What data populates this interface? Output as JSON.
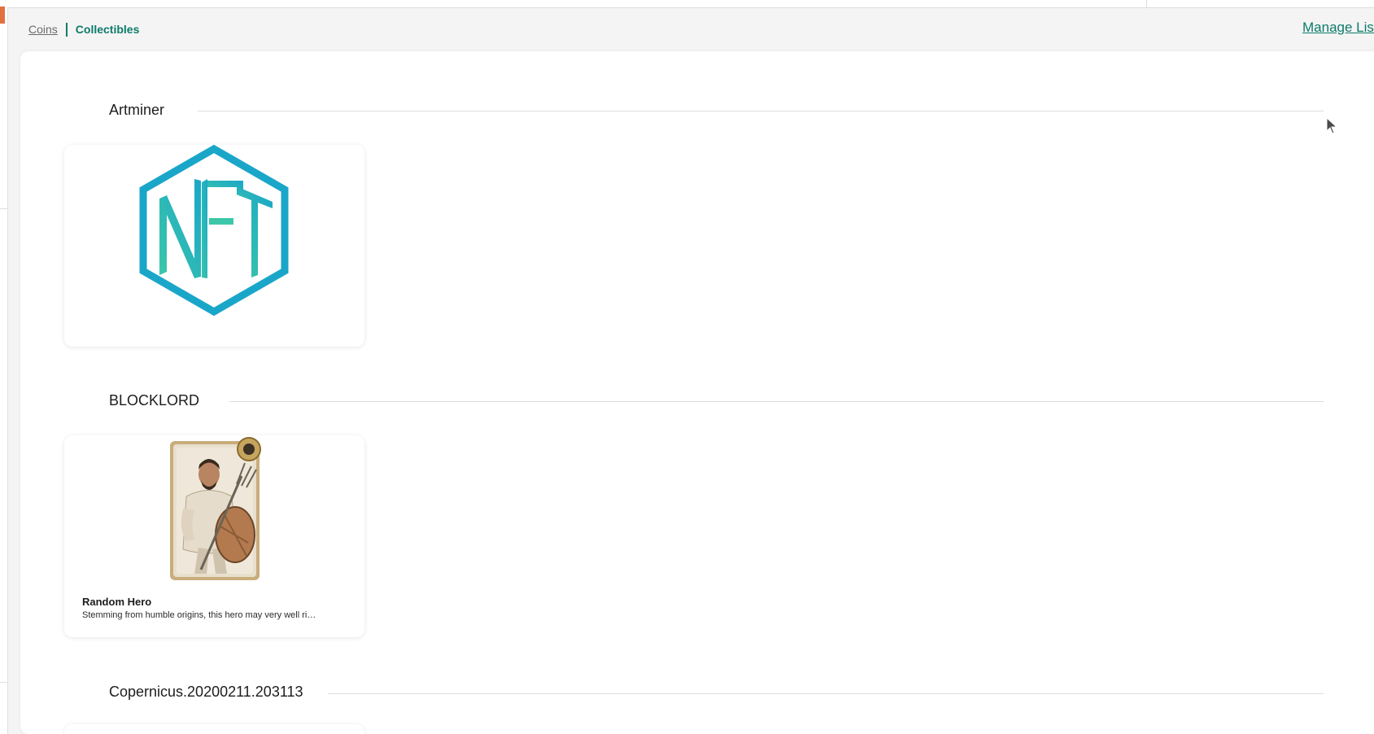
{
  "tabs": {
    "coins_label": "Coins",
    "collectibles_label": "Collectibles",
    "active": "Collectibles"
  },
  "manage_list_label": "Manage List",
  "colors": {
    "accent": "#0b7b6a",
    "nft_logo_blue": "#1aa6c9",
    "nft_logo_green": "#3cc7a8"
  },
  "groups": [
    {
      "name": "Artminer",
      "items": [
        {
          "title": "",
          "description": "",
          "image_icon": "nft-logo-icon"
        }
      ]
    },
    {
      "name": "BLOCKLORD",
      "items": [
        {
          "title": "Random Hero",
          "description": "Stemming from humble origins, this hero may very well ri…",
          "image_icon": "hero-card-image"
        }
      ]
    },
    {
      "name": "Copernicus.20200211.203113",
      "items": []
    }
  ]
}
